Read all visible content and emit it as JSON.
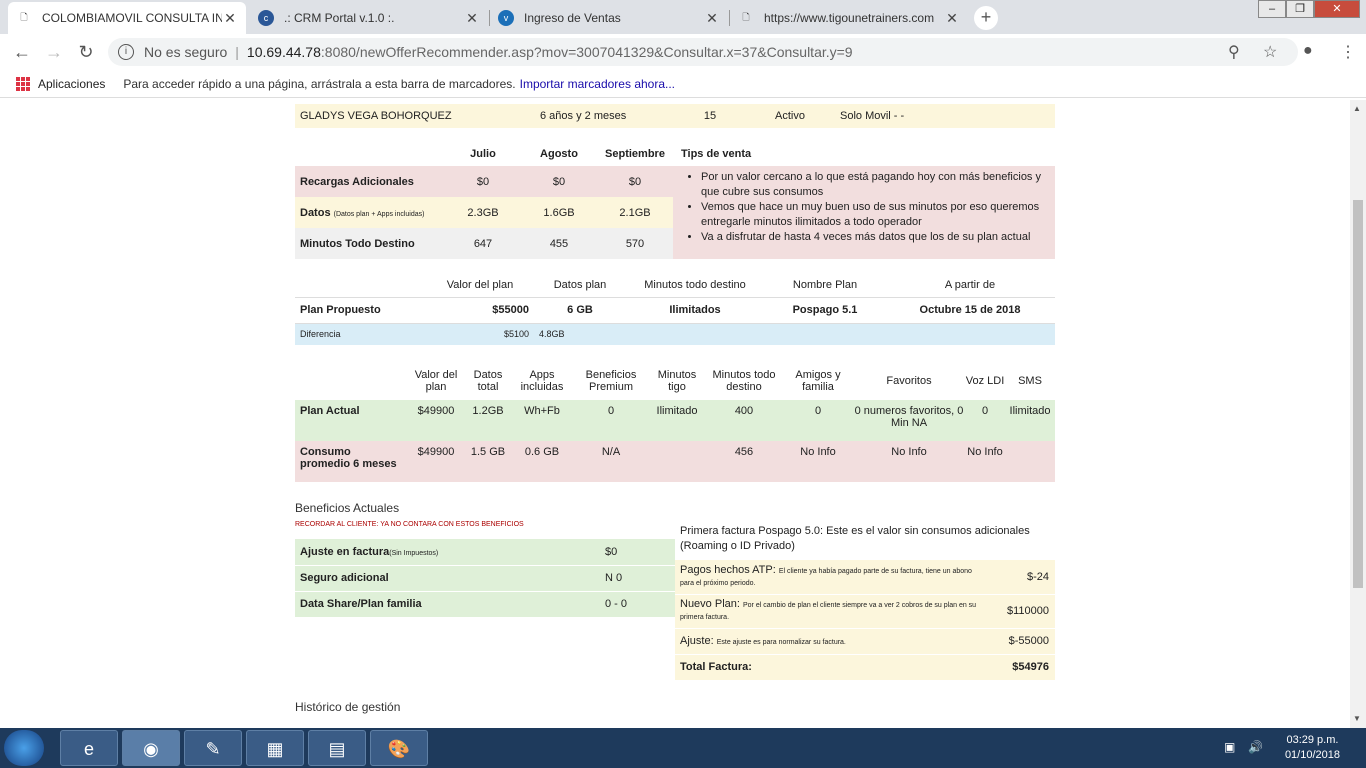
{
  "browser": {
    "tabs": [
      {
        "title": "COLOMBIAMOVIL CONSULTA IN",
        "active": true
      },
      {
        "title": ".: CRM Portal v.1.0 :."
      },
      {
        "title": "Ingreso de Ventas"
      },
      {
        "title": "https://www.tigounetrainers.com"
      }
    ],
    "not_secure": "No es seguro",
    "url_host": "10.69.44.78",
    "url_path": ":8080/newOfferRecommender.asp?mov=3007041329&Consultar.x=37&Consultar.y=9",
    "bookmarks": {
      "apps": "Aplicaciones",
      "hint": "Para acceder rápido a una página, arrástrala a esta barra de marcadores.",
      "import": "Importar marcadores ahora..."
    }
  },
  "customer": {
    "name": "GLADYS VEGA BOHORQUEZ",
    "tenure": "6 años y 2 meses",
    "num": "15",
    "status": "Activo",
    "type": "Solo Movil - -"
  },
  "usage": {
    "months": [
      "Julio",
      "Agosto",
      "Septiembre"
    ],
    "tips_header": "Tips de venta",
    "rows": [
      {
        "label": "Recargas Adicionales",
        "sub": "",
        "values": [
          "$0",
          "$0",
          "$0"
        ]
      },
      {
        "label": "Datos",
        "sub": "(Datos plan + Apps incluidas)",
        "values": [
          "2.3GB",
          "1.6GB",
          "2.1GB"
        ]
      },
      {
        "label": "Minutos Todo Destino",
        "sub": "",
        "values": [
          "647",
          "455",
          "570"
        ]
      }
    ],
    "tips": [
      "Por un valor cercano a lo que está pagando hoy con más beneficios y que cubre sus consumos",
      "Vemos que hace un muy buen uso de sus minutos por eso queremos entregarle minutos ilimitados a todo operador",
      "Va a disfrutar de hasta 4 veces más datos que los de su plan actual"
    ]
  },
  "proposed": {
    "headers": [
      "Valor del plan",
      "Datos plan",
      "Minutos todo destino",
      "Nombre Plan",
      "A partir de"
    ],
    "label": "Plan Propuesto",
    "values": [
      "$55000",
      "6 GB",
      "Ilimitados",
      "Pospago 5.1",
      "Octubre 15 de 2018"
    ],
    "diff_label": "Diferencia",
    "diff_values": [
      "$5100",
      "4.8GB"
    ]
  },
  "actual": {
    "headers": [
      "Valor del plan",
      "Datos total",
      "Apps incluidas",
      "Beneficios Premium",
      "Minutos tigo",
      "Minutos todo destino",
      "Amigos y familia",
      "Favoritos",
      "Voz LDI",
      "SMS"
    ],
    "rows": [
      {
        "label": "Plan Actual",
        "values": [
          "$49900",
          "1.2GB",
          "Wh+Fb",
          "0",
          "Ilimitado",
          "400",
          "0",
          "0 numeros favoritos, 0 Min NA",
          "0",
          "Ilimitado"
        ]
      },
      {
        "label": "Consumo promedio 6 meses",
        "values": [
          "$49900",
          "1.5 GB",
          "0.6 GB",
          "N/A",
          "",
          "456",
          "No Info",
          "No Info",
          "No Info",
          ""
        ]
      }
    ]
  },
  "benefits": {
    "title": "Beneficios Actuales",
    "note": "RECORDAR AL CLIENTE: YA NO CONTARA CON ESTOS BENEFICIOS",
    "rows": [
      {
        "label": "Ajuste en factura",
        "sub": "(Sin Impuestos)",
        "value": "$0"
      },
      {
        "label": "Seguro adicional",
        "sub": "",
        "value": "N 0"
      },
      {
        "label": "Data Share/Plan familia",
        "sub": "",
        "value": "0 - 0"
      }
    ]
  },
  "invoice": {
    "title": "Primera factura Pospago 5.0: Este es el valor sin consumos adicionales (Roaming o ID Privado)",
    "rows": [
      {
        "label": "Pagos hechos ATP:",
        "note": "El cliente ya había pagado parte de su factura, tiene un abono para el próximo periodo.",
        "value": "$-24"
      },
      {
        "label": "Nuevo Plan:",
        "note": "Por el cambio de plan el cliente siempre va a ver 2 cobros de su plan en su primera factura.",
        "value": "$110000"
      },
      {
        "label": "Ajuste:",
        "note": "Este ajuste es para normalizar su factura.",
        "value": "$-55000"
      }
    ],
    "total_label": "Total Factura:",
    "total_value": "$54976"
  },
  "history": {
    "title": "Histórico de gestión"
  },
  "taskbar": {
    "time": "03:29 p.m.",
    "date": "01/10/2018"
  }
}
